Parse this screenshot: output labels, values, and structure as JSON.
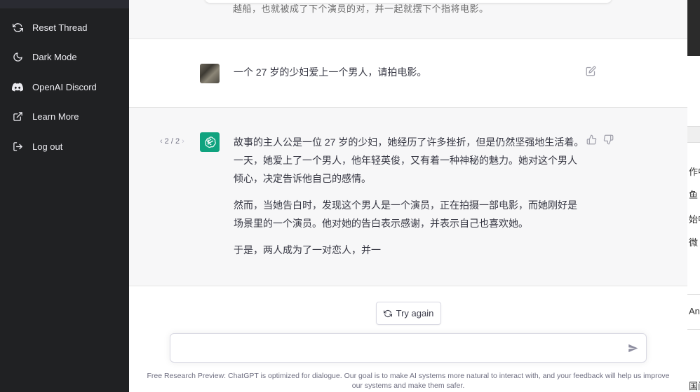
{
  "sidebar": {
    "items": [
      {
        "label": "Reset Thread",
        "icon": "refresh-icon"
      },
      {
        "label": "Dark Mode",
        "icon": "moon-icon"
      },
      {
        "label": "OpenAI Discord",
        "icon": "discord-icon"
      },
      {
        "label": "Learn More",
        "icon": "external-link-icon"
      },
      {
        "label": "Log out",
        "icon": "logout-icon"
      }
    ]
  },
  "conversation": {
    "previous_cut_text": "越船，也就被成了下个演员的对，并一起就摆下个指将电影。",
    "user_message": "一个 27 岁的少妇爱上一个男人，请拍电影。",
    "pager": {
      "current": "2",
      "total": "2",
      "display": "2 / 2"
    },
    "assistant_paragraphs": [
      "故事的主人公是一位 27 岁的少妇，她经历了许多挫折，但是仍然坚强地生活着。一天，她爱上了一个男人，他年轻英俊，又有着一种神秘的魅力。她对这个男人倾心，决定告诉他自己的感情。",
      "然而，当她告白时，发现这个男人是一个演员，正在拍摄一部电影，而她刚好是场景里的一个演员。他对她的告白表示感谢，并表示自己也喜欢她。",
      "于是，两人成为了一对恋人，并一"
    ]
  },
  "actions": {
    "try_again_label": "Try again"
  },
  "input": {
    "placeholder": "",
    "value": ""
  },
  "footer": {
    "text": "Free Research Preview: ChatGPT is optimized for dialogue. Our goal is to make AI systems more natural to interact with, and your feedback will help us improve our systems and make them safer."
  },
  "background_window": {
    "fragments": [
      "作中",
      "鱼",
      "始中",
      "微",
      "An",
      "国间"
    ]
  },
  "colors": {
    "sidebar_bg": "#202123",
    "assistant_avatar": "#10a37f",
    "assistant_row_bg": "#f7f7f8"
  }
}
